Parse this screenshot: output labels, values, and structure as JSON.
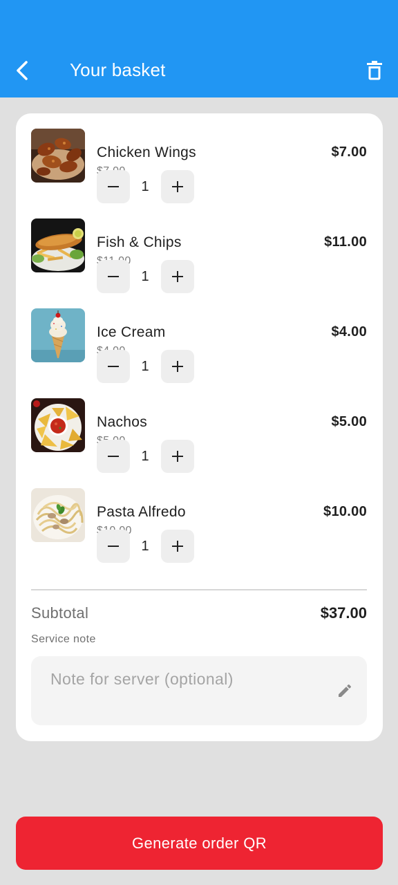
{
  "header": {
    "title": "Your basket",
    "back_icon": "chevron-left-icon",
    "delete_icon": "trash-icon",
    "color": "#2196f3"
  },
  "items": [
    {
      "name": "Chicken Wings",
      "unit_price": "$7.00",
      "total": "$7.00",
      "qty": "1",
      "image": "chicken-wings"
    },
    {
      "name": "Fish & Chips",
      "unit_price": "$11.00",
      "total": "$11.00",
      "qty": "1",
      "image": "fish-and-chips"
    },
    {
      "name": "Ice Cream",
      "unit_price": "$4.00",
      "total": "$4.00",
      "qty": "1",
      "image": "ice-cream"
    },
    {
      "name": "Nachos",
      "unit_price": "$5.00",
      "total": "$5.00",
      "qty": "1",
      "image": "nachos"
    },
    {
      "name": "Pasta Alfredo",
      "unit_price": "$10.00",
      "total": "$10.00",
      "qty": "1",
      "image": "pasta-alfredo"
    }
  ],
  "summary": {
    "subtotal_label": "Subtotal",
    "subtotal_value": "$37.00"
  },
  "note": {
    "label": "Service note",
    "placeholder": "Note for server (optional)",
    "value": ""
  },
  "cta": {
    "label": "Generate order QR",
    "color": "#ee2432"
  }
}
